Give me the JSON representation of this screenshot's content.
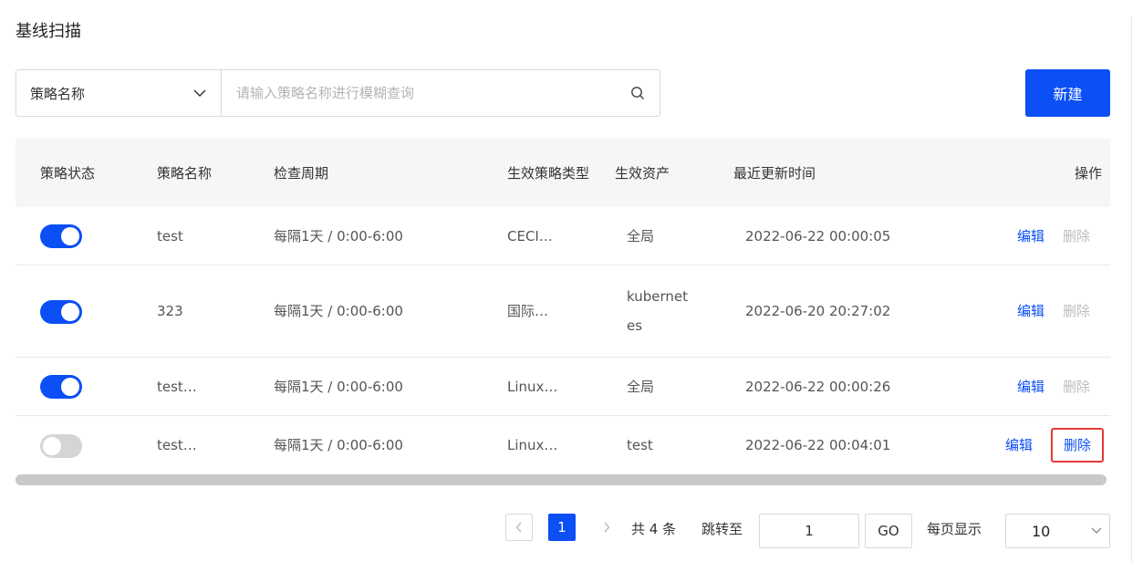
{
  "page": {
    "title": "基线扫描"
  },
  "filter": {
    "field_label": "策略名称",
    "search_placeholder": "请输入策略名称进行模糊查询",
    "search_value": ""
  },
  "toolbar": {
    "new_label": "新建"
  },
  "table": {
    "columns": [
      "策略状态",
      "策略名称",
      "检查周期",
      "生效策略类型",
      "生效资产",
      "最近更新时间",
      "操作"
    ],
    "rows": [
      {
        "enabled": true,
        "name": "test",
        "period": "每隔1天 / 0:00-6:00",
        "type": "CECI…",
        "asset": "全局",
        "updated": "2022-06-22 00:00:05",
        "edit": "编辑",
        "delete": "删除"
      },
      {
        "enabled": true,
        "name": "323",
        "period": "每隔1天 / 0:00-6:00",
        "type": "国际…",
        "asset": "kubernetes",
        "updated": "2022-06-20 20:27:02",
        "edit": "编辑",
        "delete": "删除"
      },
      {
        "enabled": true,
        "name": "test…",
        "period": "每隔1天 / 0:00-6:00",
        "type": "Linux…",
        "asset": "全局",
        "updated": "2022-06-22 00:00:26",
        "edit": "编辑",
        "delete": "删除"
      },
      {
        "enabled": false,
        "name": "test…",
        "period": "每隔1天 / 0:00-6:00",
        "type": "Linux…",
        "asset": "test",
        "updated": "2022-06-22 00:04:01",
        "edit": "编辑",
        "delete": "删除"
      }
    ]
  },
  "pagination": {
    "current_page": "1",
    "total_text": "共 4 条",
    "jump_label": "跳转至",
    "jump_value": "1",
    "go_label": "GO",
    "page_size_label": "每页显示",
    "page_size": "10"
  },
  "icons": {
    "dropdown": "chevron-down-icon",
    "search": "search-icon",
    "prev": "chevron-left-icon",
    "next": "chevron-right-icon"
  },
  "colors": {
    "primary": "#0b4ff5",
    "highlight_border": "#e53935",
    "disabled_text": "#bcbcbc"
  }
}
